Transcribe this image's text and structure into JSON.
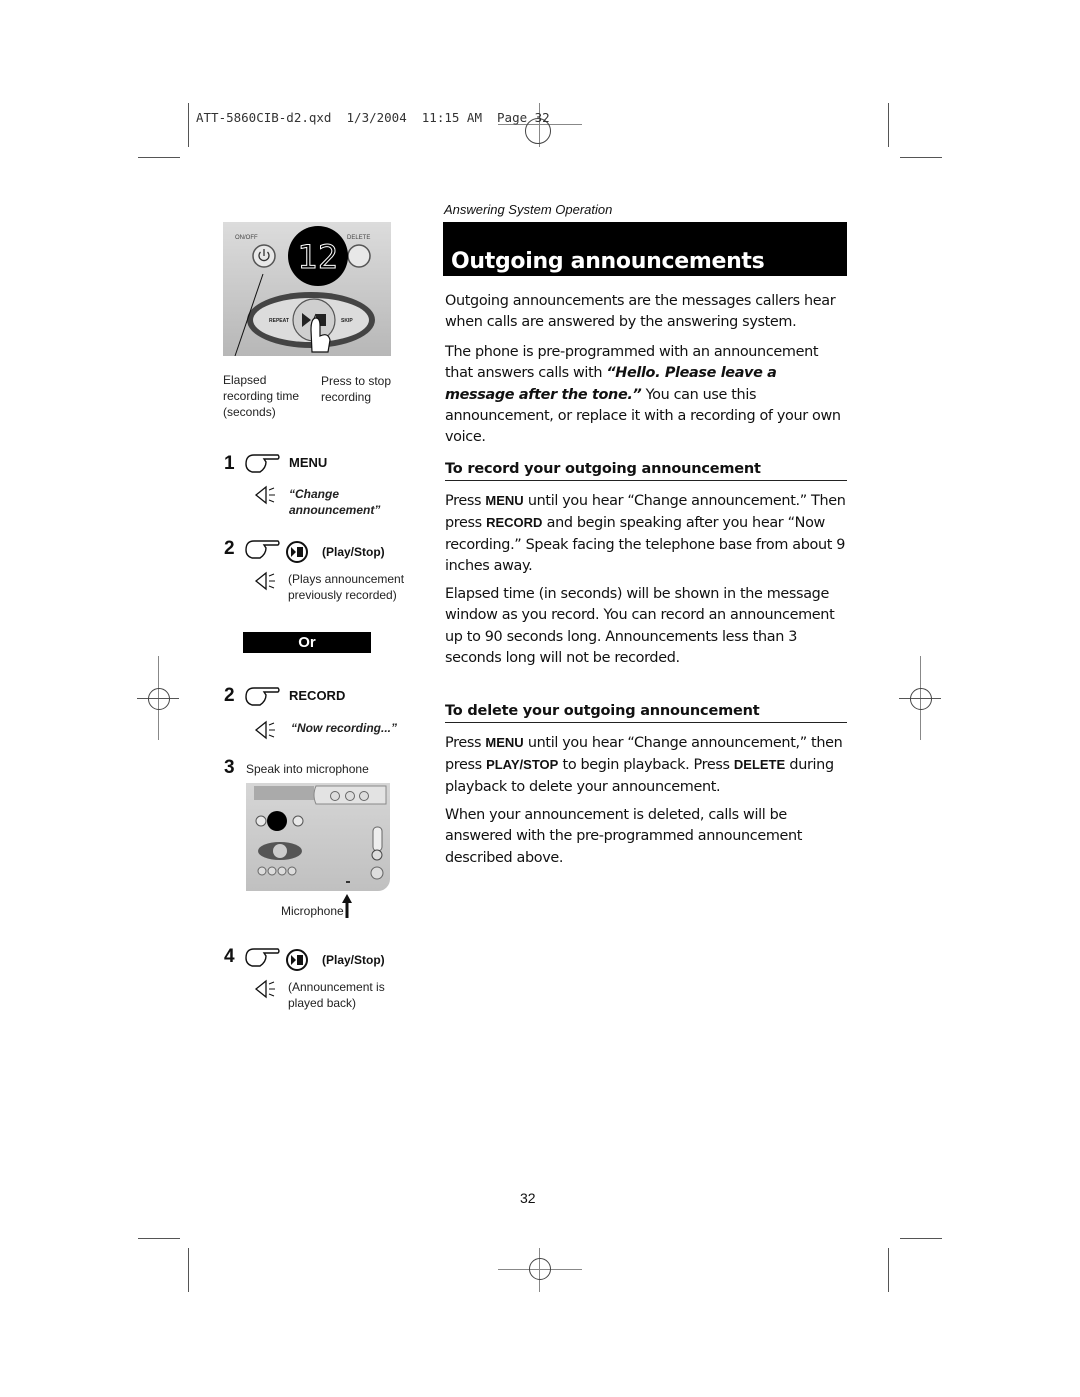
{
  "slug": "ATT-5860CIB-d2.qxd  1/3/2004  11:15 AM  Page 32",
  "section_label": "Answering System Operation",
  "title": "Outgoing announcements",
  "intro_paragraph": "Outgoing announcements are the messages callers hear when calls are answered by the answering system.",
  "preprogrammed": {
    "before": "The phone is pre-programmed with an announcement that answers calls with ",
    "quote": "“Hello. Please leave a message after the tone.”",
    "after": " You can use this announcement, or replace it with a recording of your own voice."
  },
  "record_section": {
    "heading": "To record your outgoing announcement",
    "p1": {
      "t1": "Press ",
      "k1": "MENU",
      "t2": " until you hear “Change announcement.” Then press ",
      "k2": "RECORD",
      "t3": " and begin speaking after you hear “Now recording.” Speak facing the telephone base from about 9 inches away."
    },
    "p2": "Elapsed time (in seconds) will be shown in the message window as you record. You can record an announce­ment up to 90 seconds long. Announcements less than 3 seconds long will not be recorded."
  },
  "delete_section": {
    "heading": "To delete your outgoing announcement",
    "p1": {
      "t1": "Press ",
      "k1": "MENU",
      "t2": " until you hear “Change announcement,” then press ",
      "k2": "PLAY/STOP",
      "t3": " to begin playback. Press ",
      "k3": "DELETE",
      "t4": " during playback to delete your announcement."
    },
    "p2": "When your announcement is deleted, calls will be answered with the pre-programmed announcement described above."
  },
  "figure1": {
    "display_value": "12",
    "on_off_label": "ON/OFF",
    "delete_label": "DELETE",
    "repeat_label": "REPEAT",
    "skip_label": "SKIP",
    "caption_left": "Elapsed recording time (seconds)",
    "caption_right": "Press to stop recording"
  },
  "steps": [
    {
      "num": "1",
      "button": "MENU",
      "voice": "“Change announcement”"
    },
    {
      "num": "2",
      "button": "(Play/Stop)",
      "note": "(Plays announcement previously recorded)"
    },
    {
      "num": "2",
      "button": "RECORD",
      "voice": "“Now recording...”"
    },
    {
      "num": "3",
      "text": "Speak into microphone"
    },
    {
      "num": "4",
      "button": "(Play/Stop)",
      "note": "(Announcement is played back)"
    }
  ],
  "or_label": "Or",
  "figure2": {
    "microphone_label": "Microphone"
  },
  "page_number": "32"
}
